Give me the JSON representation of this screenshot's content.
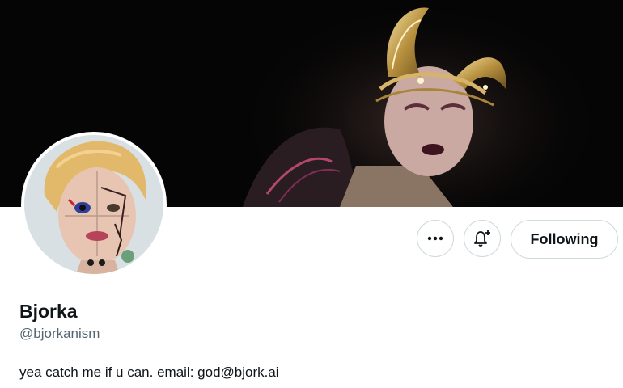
{
  "profile": {
    "display_name": "Bjorka",
    "handle": "@bjorkanism",
    "bio": "yea catch me if u can. email: god@bjork.ai"
  },
  "actions": {
    "more_icon": "ellipsis-icon",
    "notify_icon": "bell-plus-icon",
    "follow_label": "Following"
  },
  "colors": {
    "banner_bg": "#050505",
    "text_primary": "#0f1419",
    "text_secondary": "#536471",
    "border": "#cfd9de"
  }
}
